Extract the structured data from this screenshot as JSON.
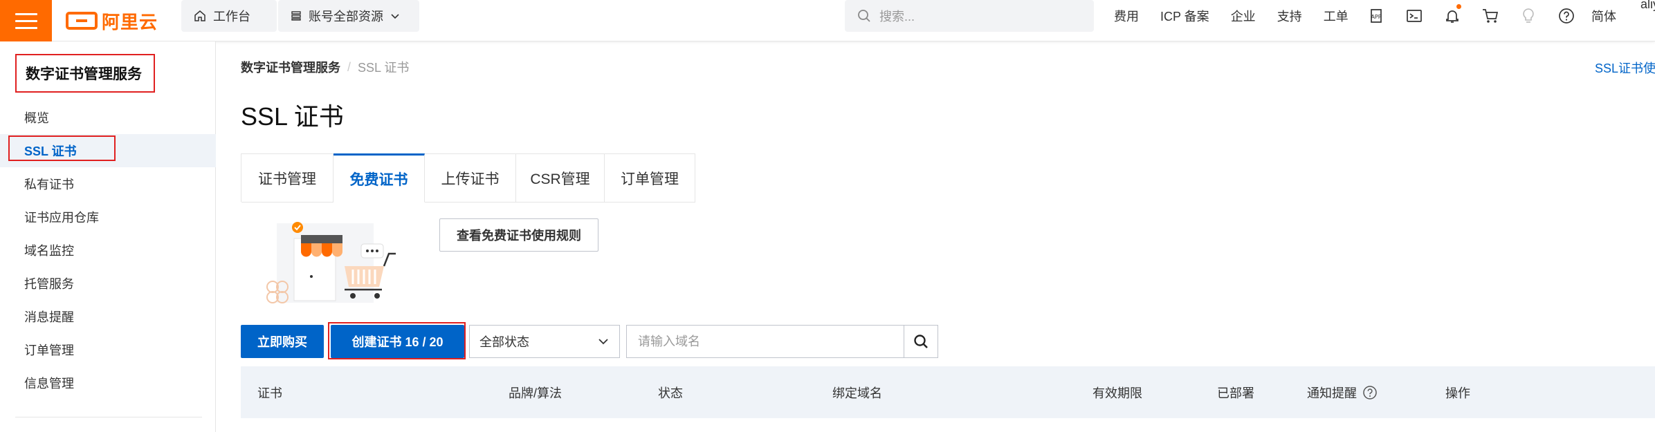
{
  "topbar": {
    "logo_text": "阿里云",
    "workbench": "工作台",
    "resources": "账号全部资源",
    "search_placeholder": "搜索...",
    "links": [
      "费用",
      "ICP 备案",
      "企业",
      "支持",
      "工单"
    ],
    "icons": [
      "app-icon",
      "terminal-icon",
      "bell-icon",
      "cart-icon",
      "bulb-icon",
      "help-icon"
    ],
    "lang": "简体",
    "user": "aliy",
    "accent_color": "#ff6a00"
  },
  "sidebar": {
    "title": "数字证书管理服务",
    "items": [
      {
        "label": "概览"
      },
      {
        "label": "SSL 证书"
      },
      {
        "label": "私有证书"
      },
      {
        "label": "证书应用仓库"
      },
      {
        "label": "域名监控"
      },
      {
        "label": "托管服务"
      },
      {
        "label": "消息提醒"
      },
      {
        "label": "订单管理"
      },
      {
        "label": "信息管理"
      }
    ],
    "active_index": 1
  },
  "breadcrumb": {
    "root": "数字证书管理服务",
    "sep": "/",
    "current": "SSL 证书"
  },
  "help_link": "SSL证书使用",
  "page_title": "SSL 证书",
  "tabs": [
    {
      "label": "证书管理"
    },
    {
      "label": "免费证书"
    },
    {
      "label": "上传证书"
    },
    {
      "label": "CSR管理"
    },
    {
      "label": "订单管理"
    }
  ],
  "active_tab": 1,
  "rules_button": "查看免费证书使用规则",
  "actions": {
    "buy_label": "立即购买",
    "create_label": "创建证书 16 / 20",
    "status_selected": "全部状态",
    "domain_placeholder": "请输入域名"
  },
  "table": {
    "columns": [
      "证书",
      "品牌/算法",
      "状态",
      "绑定域名",
      "有效期限",
      "已部署",
      "通知提醒",
      "操作"
    ]
  },
  "colors": {
    "primary": "#0064c8",
    "highlight_border": "#e02020",
    "table_header_bg": "#eff3f8"
  }
}
